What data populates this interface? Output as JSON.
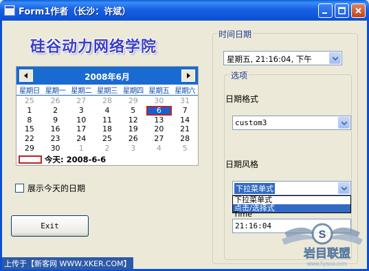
{
  "window": {
    "title": "Form1作者（长沙：许斌）"
  },
  "heading": "硅谷动力网络学院",
  "calendar": {
    "month_label": "2008年6月",
    "weekdays": [
      "星期日",
      "星期一",
      "星期二",
      "星期三",
      "星期四",
      "星期五",
      "星期六"
    ],
    "days": [
      {
        "d": "25",
        "other": true
      },
      {
        "d": "26",
        "other": true
      },
      {
        "d": "27",
        "other": true
      },
      {
        "d": "28",
        "other": true
      },
      {
        "d": "29",
        "other": true
      },
      {
        "d": "30",
        "other": true
      },
      {
        "d": "31",
        "other": true
      },
      {
        "d": "1"
      },
      {
        "d": "2"
      },
      {
        "d": "3"
      },
      {
        "d": "4"
      },
      {
        "d": "5"
      },
      {
        "d": "6",
        "selected": true
      },
      {
        "d": "7"
      },
      {
        "d": "8"
      },
      {
        "d": "9"
      },
      {
        "d": "10"
      },
      {
        "d": "11"
      },
      {
        "d": "12"
      },
      {
        "d": "13"
      },
      {
        "d": "14"
      },
      {
        "d": "15"
      },
      {
        "d": "16"
      },
      {
        "d": "17"
      },
      {
        "d": "18"
      },
      {
        "d": "19"
      },
      {
        "d": "20"
      },
      {
        "d": "21"
      },
      {
        "d": "22"
      },
      {
        "d": "23"
      },
      {
        "d": "24"
      },
      {
        "d": "25"
      },
      {
        "d": "26"
      },
      {
        "d": "27"
      },
      {
        "d": "28"
      },
      {
        "d": "29"
      },
      {
        "d": "30"
      },
      {
        "d": "1",
        "other": true
      },
      {
        "d": "2",
        "other": true
      },
      {
        "d": "3",
        "other": true
      },
      {
        "d": "4",
        "other": true
      },
      {
        "d": "5",
        "other": true
      }
    ],
    "today_label": "今天: 2008-6-6"
  },
  "checkbox": {
    "label": "展示今天的日期",
    "checked": false
  },
  "exit_button": "Exit",
  "footer": "上传于【新客网 WWW.XKER.COM】",
  "datetime_group": {
    "legend": "时间日期",
    "picker_value": "星期五, 21:16:04, 下午",
    "options_legend": "选项",
    "format_label": "日期格式",
    "format_value": "custom3",
    "style_label": "日期风格",
    "style_value": "下拉菜单式",
    "style_options": [
      "下拉菜单式",
      "点击/选择式"
    ],
    "time_label": "Time",
    "time_value": "21:16:04"
  },
  "watermark": {
    "logo_text": "S",
    "brand": "岩目联盟",
    "site": "www.5yaoe.com"
  },
  "colors": {
    "titlebar": "#0a4fd0",
    "calendar_header": "#1a6bd1",
    "selection": "#316ac5",
    "today_border": "#c21f1f",
    "groupbox_text": "#1f3a93"
  }
}
